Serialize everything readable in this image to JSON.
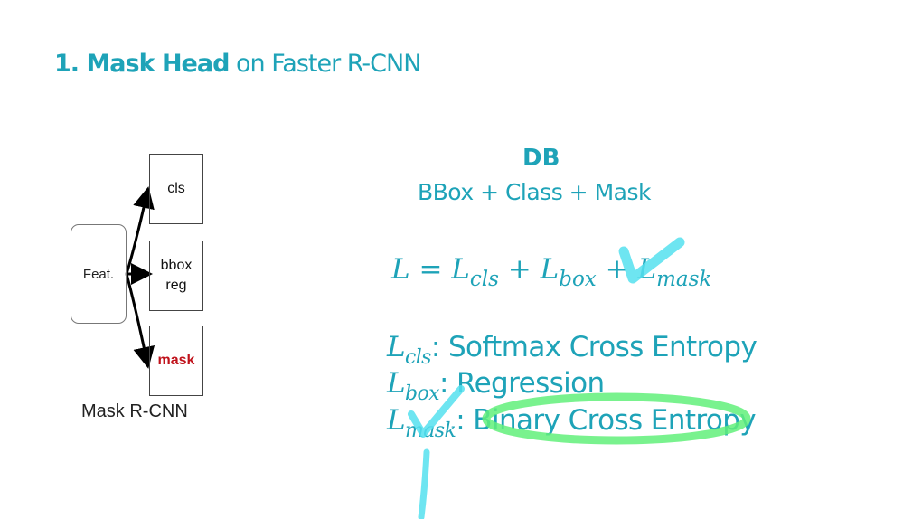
{
  "title": {
    "bold": "1. Mask Head",
    "rest": " on Faster R-CNN"
  },
  "diagram": {
    "feat": "Feat.",
    "heads": [
      "cls",
      "bbox\nreg",
      "mask"
    ],
    "caption": "Mask R-CNN"
  },
  "db": {
    "label": "DB",
    "subtitle": "BBox + Class + Mask"
  },
  "loss": {
    "L": "L",
    "eq": "=",
    "t1": "L",
    "t1sub": "cls",
    "plus1": "+",
    "t2": "L",
    "t2sub": "box",
    "plus2": "+",
    "t3": "L",
    "t3sub": "mask"
  },
  "definitions": [
    {
      "sym": "L",
      "sub": "cls",
      "text": ": Softmax Cross Entropy"
    },
    {
      "sym": "L",
      "sub": "box",
      "text": ": Regression"
    },
    {
      "sym": "L",
      "sub": "mask",
      "text": ": Binary Cross Entropy"
    }
  ],
  "colors": {
    "accent": "#1ea3b8",
    "mask_red": "#c0121b",
    "highlight_cyan": "#55e0ee",
    "highlight_green": "#62f07a"
  }
}
